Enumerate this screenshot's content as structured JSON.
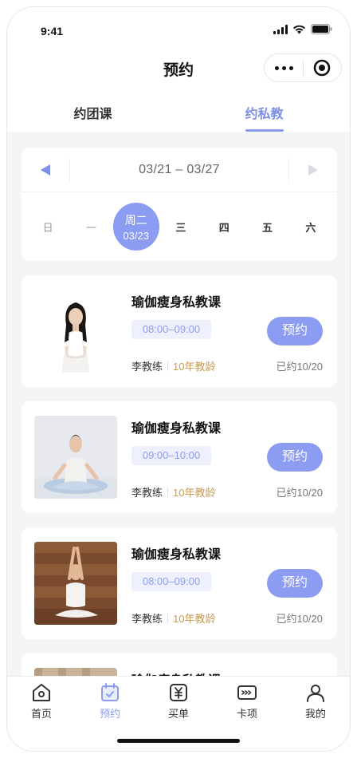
{
  "status_bar": {
    "time": "9:41"
  },
  "navbar": {
    "title": "预约",
    "more_icon": "more-dots-icon",
    "target_icon": "target-icon"
  },
  "tabs": [
    {
      "label": "约团课",
      "active": false
    },
    {
      "label": "约私教",
      "active": true
    }
  ],
  "week": {
    "range": "03/21 – 03/27",
    "prev_icon": "triangle-left-icon",
    "next_icon": "triangle-right-icon",
    "days": [
      {
        "name": "日",
        "date": ""
      },
      {
        "name": "一",
        "date": ""
      },
      {
        "name": "周二",
        "date": "03/23",
        "active": true
      },
      {
        "name": "三",
        "date": ""
      },
      {
        "name": "四",
        "date": ""
      },
      {
        "name": "五",
        "date": ""
      },
      {
        "name": "六",
        "date": ""
      }
    ]
  },
  "courses": [
    {
      "name": "瑜伽瘦身私教课",
      "time": "08:00–09:00",
      "coach": "李教练",
      "experience": "10年教龄",
      "booked": "已约10/20",
      "book_label": "预约"
    },
    {
      "name": "瑜伽瘦身私教课",
      "time": "09:00–10:00",
      "coach": "李教练",
      "experience": "10年教龄",
      "booked": "已约10/20",
      "book_label": "预约"
    },
    {
      "name": "瑜伽瘦身私教课",
      "time": "08:00–09:00",
      "coach": "李教练",
      "experience": "10年教龄",
      "booked": "已约10/20",
      "book_label": "预约"
    },
    {
      "name": "瑜伽瘦身私教课"
    }
  ],
  "tabbar": [
    {
      "label": "首页",
      "icon": "home-icon"
    },
    {
      "label": "预约",
      "icon": "calendar-icon",
      "active": true
    },
    {
      "label": "买单",
      "icon": "yuan-icon"
    },
    {
      "label": "卡项",
      "icon": "card-icon"
    },
    {
      "label": "我的",
      "icon": "user-icon"
    }
  ],
  "colors": {
    "accent": "#8c9cf2",
    "tag_bg": "#eef1fd",
    "gold": "#c69a52",
    "bg": "#f4f5f7"
  }
}
